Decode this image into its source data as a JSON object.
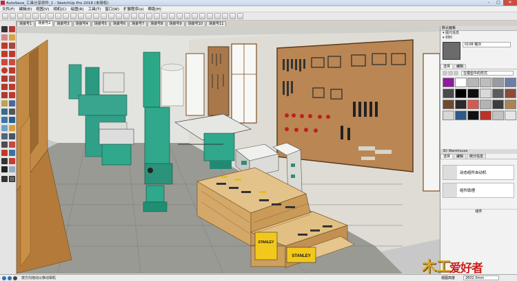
{
  "window": {
    "title": "AutoSave_工具分享原件_1 - SketchUp Pro 2018 (未授权)",
    "min_glyph": "–",
    "max_glyph": "□",
    "close_glyph": "✕"
  },
  "menu": [
    "文件(F)",
    "编辑(E)",
    "视图(V)",
    "相机(C)",
    "绘图(R)",
    "工具(T)",
    "窗口(W)",
    "扩展程序(x)",
    "帮助(H)"
  ],
  "scene_tabs": [
    "场景号1",
    "场景号2",
    "场景号3",
    "场景号4",
    "场景号5",
    "场景号6",
    "场景号7",
    "场景号8",
    "场景号9",
    "场景号10",
    "场景号11"
  ],
  "active_scene_index": 1,
  "right_panel": {
    "tray_title": "默认面板",
    "materials_header": "▾ 图元信息",
    "material_subheader": "▾ 材料",
    "material_name": "0108 釉灰",
    "tabs": [
      "选择",
      "编辑"
    ],
    "library_select": "在模型中的样式",
    "components_header": "3D Warehouse",
    "components_tabs": [
      "选择",
      "编辑",
      "统计信息"
    ],
    "components": [
      {
        "name": "动态组件自动机"
      },
      {
        "name": "组件助理"
      }
    ],
    "components_footer": "组件"
  },
  "status": {
    "hint": "按方向拖动以移动相机",
    "measure_label": "视图高度",
    "measure_value": "2602.0mm"
  },
  "viewport_labels": {
    "stanley_1": "STANLEY",
    "stanley_2": "STANLEY"
  },
  "logo": {
    "part1": "木工",
    "part2": "爱好者"
  },
  "swatch_colors": [
    "#8f1b9c",
    "#ffffff",
    "#b7b7b7",
    "#bdbdbd",
    "#9a9aa6",
    "#6c7ea8",
    "#4a4a4a",
    "#000000",
    "#101010",
    "#d9d9d9",
    "#5c5c5c",
    "#8b4a3a",
    "#6d4a2f",
    "#2a2a2a",
    "#d25a53",
    "#b3b3b3",
    "#3d3d3d",
    "#a88457",
    "#d7d7d7",
    "#2d5a87",
    "#111111",
    "#b83228",
    "#c2c2c2",
    "#e6e6e6"
  ]
}
